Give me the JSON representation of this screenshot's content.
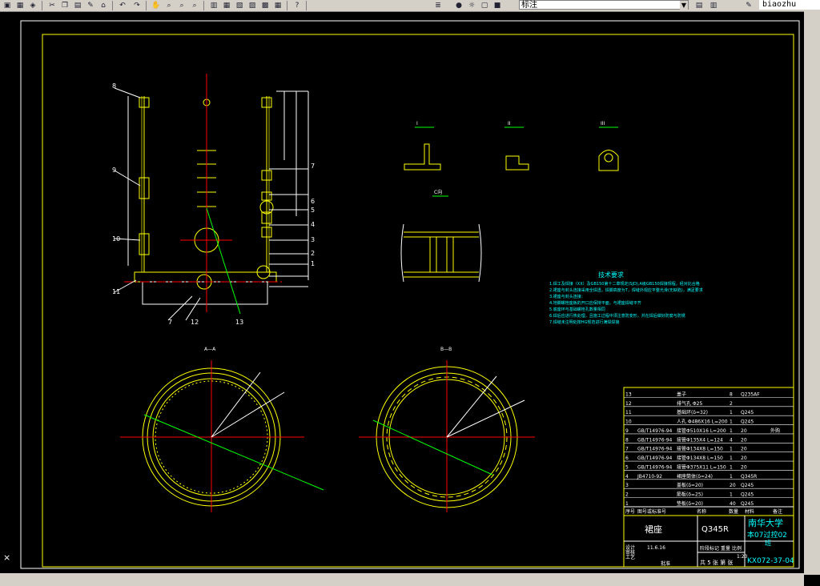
{
  "toolbar": {
    "layer_value": "标注",
    "command_value": "biaozhu"
  },
  "drawing": {
    "main_labels": [
      "8",
      "9",
      "10",
      "11",
      "7",
      "6",
      "5",
      "4",
      "3",
      "2",
      "1",
      "7",
      "12",
      "13"
    ],
    "section_labels": [
      "A—A",
      "B—B",
      "I",
      "II",
      "III",
      "C向"
    ],
    "tech_title": "技术要求",
    "tech_lines": [
      "1.焊工及焊接（XX）及GB150第十二章规定(SJD),A级GB150焊接规程，经对比合格",
      "2.裙座与封头连接采用全焊透，焊脚高度为T，焊缝外观应平整光滑(无缺陷)，满足要求",
      "3.裙座与封头连接：",
      "4.地脚螺栓座板的开口应保持平面，与裙座焊缝平齐",
      "5.底座环与基础螺栓孔数量相同",
      "6.焊后应进行热处理，且施工过程中须注意防变形，并在焊后做好防腐与防锈",
      "7.焊缝未注明处按HG规范进行满焊焊接"
    ],
    "bom_rows": [
      [
        "13",
        "",
        "盖子",
        "8",
        "Q235AF",
        ""
      ],
      [
        "12",
        "",
        "排气孔 Φ25",
        "2",
        "",
        ""
      ],
      [
        "11",
        "",
        "基础环(δ=32)",
        "1",
        "Q245",
        ""
      ],
      [
        "10",
        "",
        "人孔 Φ486X16 L=200",
        "1",
        "Q245",
        ""
      ],
      [
        "9",
        "GB/T14976-94",
        "接管Φ510X16 L=200",
        "1",
        "20",
        "外购"
      ],
      [
        "8",
        "GB/T14976-94",
        "接管Φ135X4 L=124",
        "4",
        "20",
        ""
      ],
      [
        "7",
        "GB/T14976-94",
        "接管Φ134X8 L=150",
        "1",
        "20",
        ""
      ],
      [
        "6",
        "GB/T14976-94",
        "接管Φ134X8 L=150",
        "1",
        "20",
        ""
      ],
      [
        "5",
        "GB/T14976-94",
        "接管Φ375X11 L=150",
        "1",
        "20",
        ""
      ],
      [
        "4",
        "JB4710-92",
        "裙座筒体(δ=24)",
        "1",
        "Q345R",
        ""
      ],
      [
        "3",
        "",
        "盖板(δ=20)",
        "20",
        "Q245",
        ""
      ],
      [
        "2",
        "",
        "筋板(δ=25)",
        "1",
        "Q245",
        ""
      ],
      [
        "1",
        "",
        "垫板(δ=20)",
        "40",
        "Q245",
        ""
      ]
    ],
    "bom_header": [
      "序号",
      "图号或标准号",
      "名称",
      "数量",
      "材料",
      "备注"
    ],
    "title_name": "裙座",
    "title_material": "Q345R",
    "school": "南华大学",
    "class": "本07过控02",
    "school_sub": "班",
    "drawing_no": "KX072-37-04",
    "sheet_info": "共 5 张  第 张",
    "scale": "1:20",
    "stage_marks": "阶段标记",
    "weight_label": "重量",
    "scale_label": "比例",
    "row_labels": [
      "设计",
      "审核",
      "工艺",
      "日期",
      "标准化",
      "批准"
    ],
    "date_value": "11.6.16"
  },
  "colors": {
    "background": "#000000",
    "frame": "#ffffff",
    "inner_frame": "#ffff00",
    "geometry": "#ffff00",
    "center": "#ff0000",
    "dimension": "#00ff00",
    "text_cyan": "#00ffff"
  }
}
